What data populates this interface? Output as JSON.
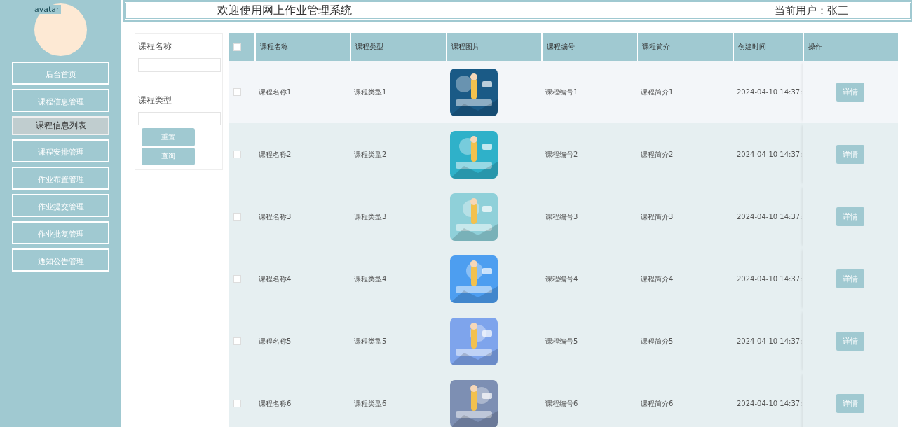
{
  "sidebar": {
    "avatar_alt": "avatar",
    "items": [
      {
        "label": "后台首页",
        "selected": false
      },
      {
        "label": "课程信息管理",
        "selected": false
      },
      {
        "label": "课程信息列表",
        "selected": true
      },
      {
        "label": "课程安排管理",
        "selected": false
      },
      {
        "label": "作业布置管理",
        "selected": false
      },
      {
        "label": "作业提交管理",
        "selected": false
      },
      {
        "label": "作业批复管理",
        "selected": false
      },
      {
        "label": "通知公告管理",
        "selected": false
      }
    ]
  },
  "header": {
    "title": "欢迎使用网上作业管理系统",
    "current_user": "当前用户：张三"
  },
  "filters": {
    "fields": [
      {
        "label": "课程名称"
      },
      {
        "label": "课程类型"
      }
    ],
    "buttons": [
      "重置",
      "查询"
    ]
  },
  "table": {
    "select_all_checked": false,
    "columns": [
      "课程名称",
      "课程类型",
      "课程图片",
      "课程编号",
      "课程简介",
      "创建时间",
      "操作"
    ],
    "rows": [
      {
        "checked": false,
        "hovered": true,
        "name": "课程名称1",
        "type": "课程类型1",
        "code": "课程编号1",
        "intro": "课程简介1",
        "created": "2024-04-10 14:37:",
        "action": "详情"
      },
      {
        "checked": false,
        "hovered": false,
        "name": "课程名称2",
        "type": "课程类型2",
        "code": "课程编号2",
        "intro": "课程简介2",
        "created": "2024-04-10 14:37:",
        "action": "详情"
      },
      {
        "checked": false,
        "hovered": false,
        "name": "课程名称3",
        "type": "课程类型3",
        "code": "课程编号3",
        "intro": "课程简介3",
        "created": "2024-04-10 14:37:",
        "action": "详情"
      },
      {
        "checked": false,
        "hovered": false,
        "name": "课程名称4",
        "type": "课程类型4",
        "code": "课程编号4",
        "intro": "课程简介4",
        "created": "2024-04-10 14:37:",
        "action": "详情"
      },
      {
        "checked": false,
        "hovered": false,
        "name": "课程名称5",
        "type": "课程类型5",
        "code": "课程编号5",
        "intro": "课程简介5",
        "created": "2024-04-10 14:37:",
        "action": "详情"
      },
      {
        "checked": false,
        "hovered": false,
        "name": "课程名称6",
        "type": "课程类型6",
        "code": "课程编号6",
        "intro": "课程简介6",
        "created": "2024-04-10 14:37:",
        "action": "详情"
      }
    ]
  }
}
